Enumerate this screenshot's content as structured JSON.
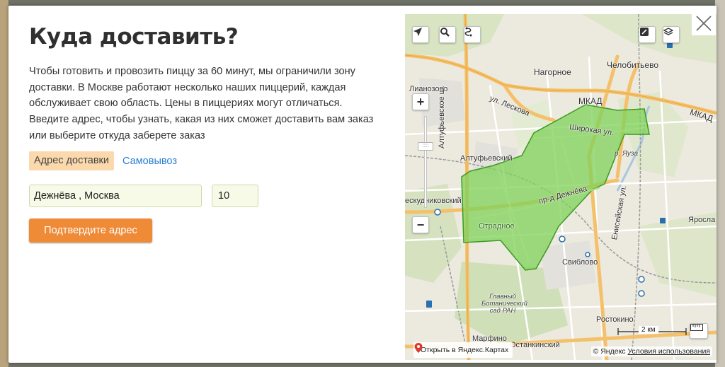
{
  "modal": {
    "title": "Куда доставить?",
    "description": "Чтобы готовить и провозить пиццу за 60 минут, мы ограничили зону доставки. В Москве работают несколько наших пиццерий, каждая обслуживает свою область. Цены в пиццериях могут отличаться. Введите адрес, чтобы узнать, какая из них сможет доставить вам заказ или выберите откуда заберете заказ",
    "tabs": [
      {
        "label": "Адрес доставки",
        "active": true
      },
      {
        "label": "Самовывоз",
        "active": false
      }
    ],
    "address_input": {
      "value": "Дежнёва , Москва"
    },
    "house_input": {
      "value": "10"
    },
    "confirm_button": "Подтвердите адрес",
    "close_icon": "close-icon"
  },
  "map": {
    "labels": {
      "nagornoe": "Нагорное",
      "chelobitevo": "Челобитьево",
      "lianozovo": "Лианозово",
      "leskova": "ул. Лескова",
      "mkad1": "МКАД",
      "mkad2": "МКАД",
      "altufevskoe": "Алтуфьевское ш.",
      "shirokaya": "Широкая ул.",
      "yauza": "р. Яуза",
      "altufevsky": "Алтуфьевский",
      "sviblovo": "Свиблово",
      "eniseyskaya": "Енисейская ул.",
      "dezhneva": "пр-д Дежнёва",
      "otradnoe": "Отрадное",
      "yaroslavl": "Яросла",
      "skudninkovsky": "ескудниковский",
      "botanical": "Главный Ботанический сад РАН",
      "rostokino": "Ростокино",
      "marfino": "Марфино",
      "ostankinsky": "Останкинский"
    },
    "controls": {
      "locate": "location-arrow-icon",
      "search": "search-icon",
      "route": "route-icon",
      "traffic": "traffic-icon",
      "layers": "layers-icon",
      "zoom_in": "+",
      "zoom_out": "−",
      "ruler": "ruler-icon"
    },
    "scale_label": "2 км",
    "open_in_yandex": "Открыть в Яндекс.Картах",
    "copyright": "© Яндекс",
    "terms": "Условия использования",
    "zone_color": "#7fd15a",
    "zone_border": "#3c9a1e",
    "road_color": "#f5c06a"
  }
}
